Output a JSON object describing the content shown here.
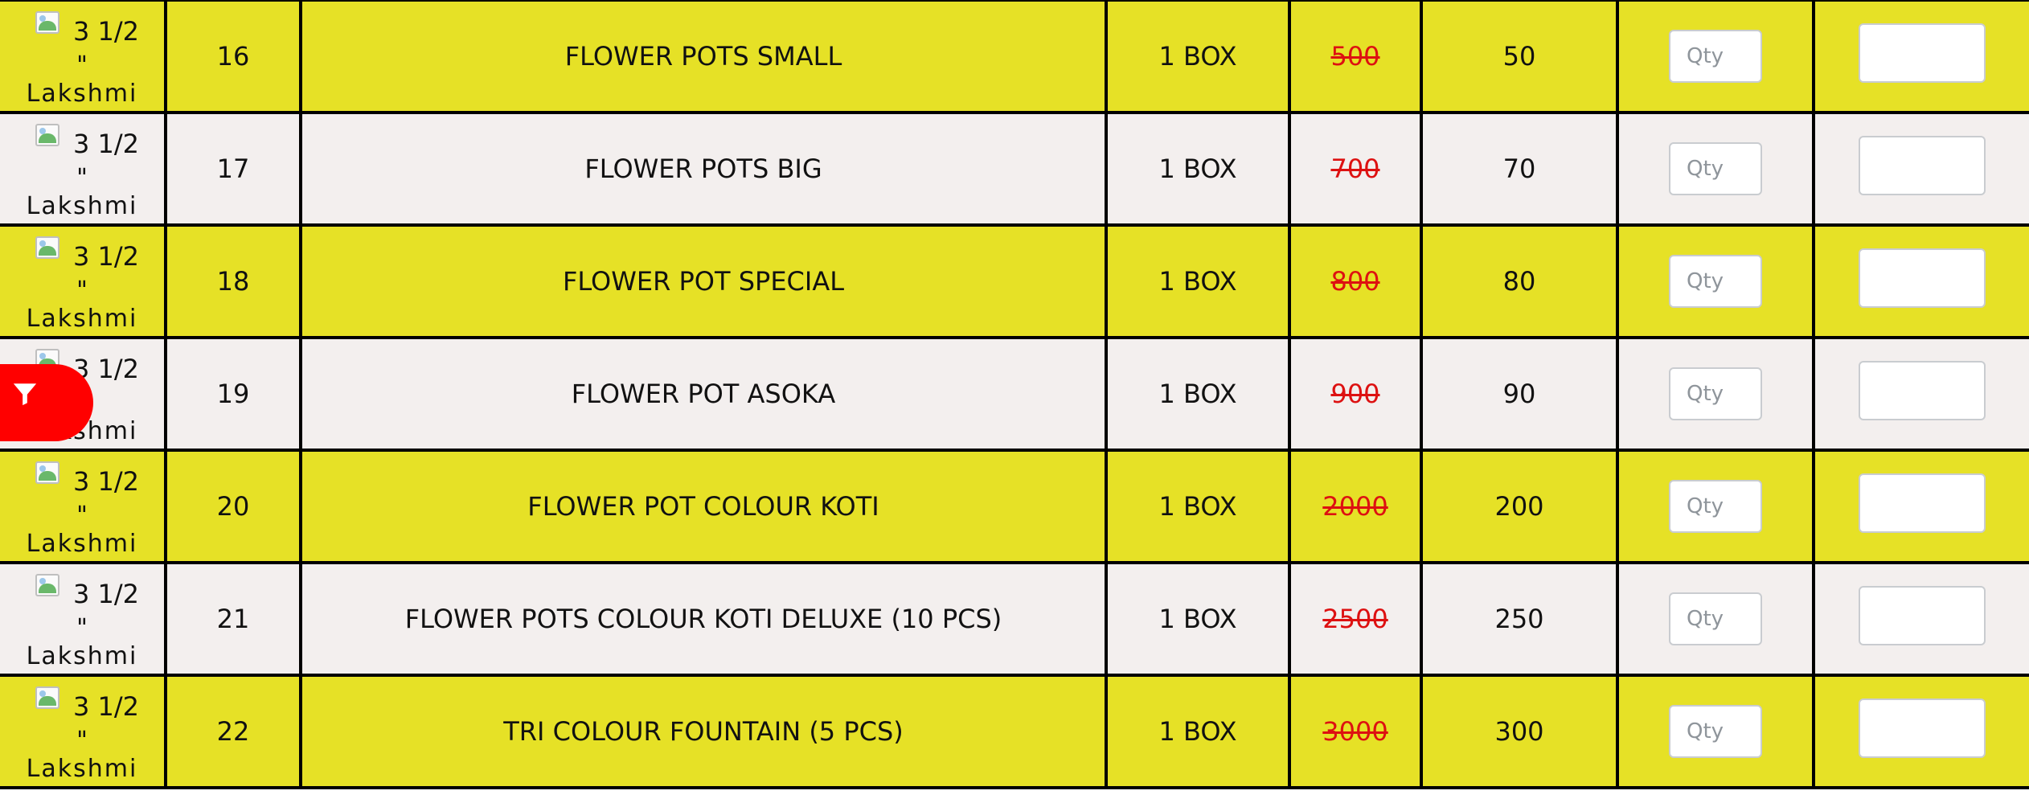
{
  "colors": {
    "row_yellow": "#e6e126",
    "row_white": "#f3efee",
    "strike_red": "#dd1111",
    "filter_button": "#ff0000"
  },
  "filter_button": {
    "icon": "filter-icon"
  },
  "qty_placeholder": "Qty",
  "rows": [
    {
      "img_alt": [
        "3 1/2",
        "\"",
        "Lakshmi"
      ],
      "sno": "16",
      "name": "FLOWER POTS SMALL",
      "content": "1 BOX",
      "actual_price": "500",
      "price": "50"
    },
    {
      "img_alt": [
        "3 1/2",
        "\"",
        "Lakshmi"
      ],
      "sno": "17",
      "name": "FLOWER POTS BIG",
      "content": "1 BOX",
      "actual_price": "700",
      "price": "70"
    },
    {
      "img_alt": [
        "3 1/2",
        "\"",
        "Lakshmi"
      ],
      "sno": "18",
      "name": "FLOWER POT SPECIAL",
      "content": "1 BOX",
      "actual_price": "800",
      "price": "80"
    },
    {
      "img_alt": [
        "3 1/2",
        "\"",
        "Lakshmi"
      ],
      "sno": "19",
      "name": "FLOWER POT ASOKA",
      "content": "1 BOX",
      "actual_price": "900",
      "price": "90"
    },
    {
      "img_alt": [
        "3 1/2",
        "\"",
        "Lakshmi"
      ],
      "sno": "20",
      "name": "FLOWER POT COLOUR KOTI",
      "content": "1 BOX",
      "actual_price": "2000",
      "price": "200"
    },
    {
      "img_alt": [
        "3 1/2",
        "\"",
        "Lakshmi"
      ],
      "sno": "21",
      "name": "FLOWER POTS COLOUR KOTI DELUXE (10 PCS)",
      "content": "1 BOX",
      "actual_price": "2500",
      "price": "250"
    },
    {
      "img_alt": [
        "3 1/2",
        "\"",
        "Lakshmi"
      ],
      "sno": "22",
      "name": "TRI COLOUR FOUNTAIN (5 PCS)",
      "content": "1 BOX",
      "actual_price": "3000",
      "price": "300"
    }
  ]
}
